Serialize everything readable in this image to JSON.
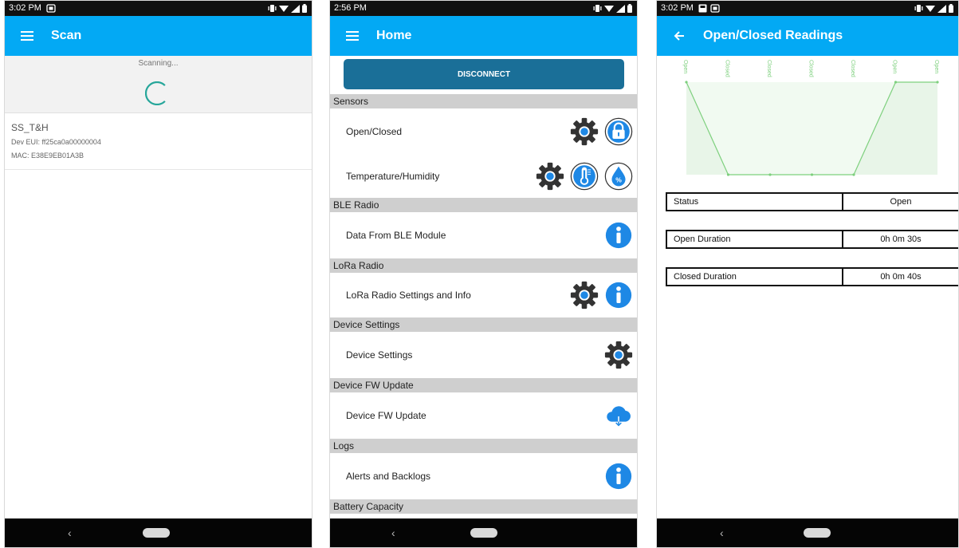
{
  "screens": {
    "scan": {
      "status_time": "3:02 PM",
      "title": "Scan",
      "scanning_text": "Scanning...",
      "devices": [
        {
          "name": "SS_T&H",
          "dev_eui": "Dev EUI: ff25ca0a00000004",
          "mac": "MAC: E38E9EB01A3B"
        }
      ]
    },
    "home": {
      "status_time": "2:56 PM",
      "title": "Home",
      "disconnect_label": "DISCONNECT",
      "sections": {
        "sensors": "Sensors",
        "ble_radio": "BLE Radio",
        "lora_radio": "LoRa Radio",
        "device_settings": "Device Settings",
        "device_fw_update": "Device FW Update",
        "logs": "Logs",
        "battery": "Battery Capacity"
      },
      "rows": {
        "open_closed": "Open/Closed",
        "temp_humidity": "Temperature/Humidity",
        "ble_data": "Data From BLE Module",
        "lora_settings": "LoRa Radio Settings and Info",
        "device_settings": "Device Settings",
        "device_fw_update": "Device FW Update",
        "alerts": "Alerts and Backlogs"
      }
    },
    "readings": {
      "status_time": "3:02 PM",
      "title": "Open/Closed Readings",
      "table": [
        {
          "label": "Status",
          "value": "Open"
        },
        {
          "label": "Open Duration",
          "value": "0h 0m 30s"
        },
        {
          "label": "Closed Duration",
          "value": "0h 0m 40s"
        }
      ]
    }
  },
  "chart_data": {
    "type": "area",
    "x": [
      1,
      2,
      3,
      4,
      5,
      6,
      7
    ],
    "categories": [
      "Open",
      "Closed",
      "Closed",
      "Closed",
      "Closed",
      "Open",
      "Open"
    ],
    "values": [
      1,
      0,
      0,
      0,
      0,
      1,
      1
    ],
    "color": "#7ed07e",
    "fill": "#e8f5e8"
  },
  "colors": {
    "app_bar": "#03a9f4",
    "disconnect": "#1a6f98",
    "section_header": "#cfcfcf",
    "spinner": "#26a69a",
    "info_blue": "#1e88e5",
    "gear": "#333333"
  },
  "icons": {
    "menu": "menu-icon",
    "back": "arrow-back-icon",
    "gear": "gear-icon",
    "lock": "lock-icon",
    "thermometer": "thermometer-icon",
    "humidity": "humidity-icon",
    "info": "info-icon",
    "cloud_download": "cloud-download-icon"
  }
}
